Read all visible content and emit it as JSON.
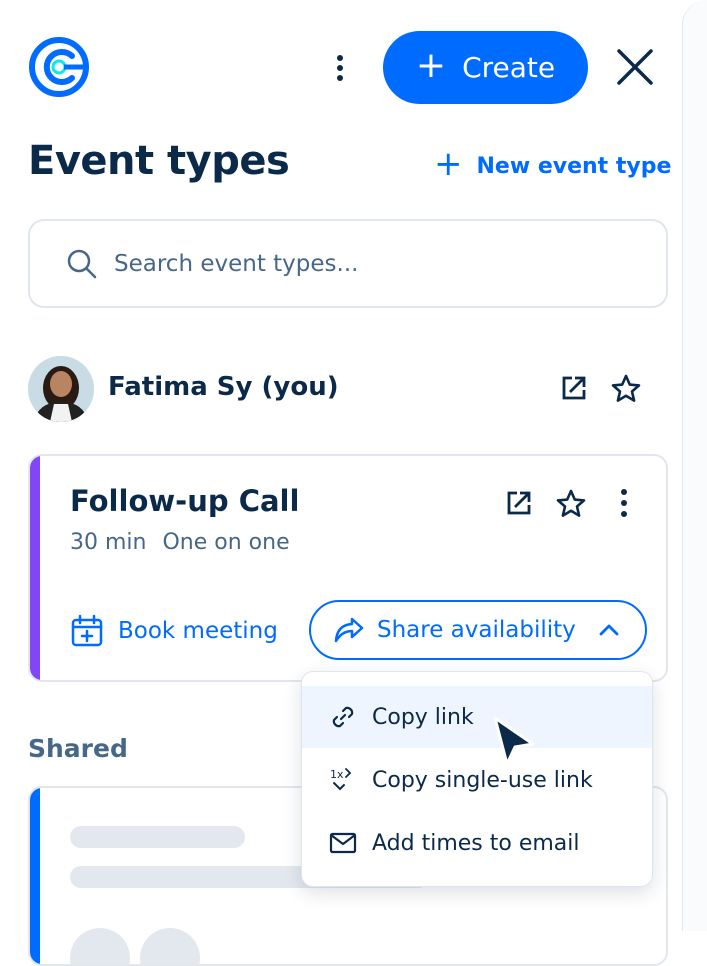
{
  "header": {
    "create_label": "Create",
    "more_icon": "vertical-dots-icon",
    "close_icon": "close-x-icon",
    "logo_icon": "calendly-logo"
  },
  "page": {
    "title": "Event types",
    "new_event_label": "New event type"
  },
  "search": {
    "placeholder": "Search event types..."
  },
  "user": {
    "name": "Fatima Sy (you)"
  },
  "event_card": {
    "title": "Follow-up Call",
    "duration": "30 min",
    "kind": "One on one",
    "book_label": "Book meeting",
    "share_label": "Share availability",
    "accent_color": "#8247f5"
  },
  "share_menu": {
    "items": [
      {
        "label": "Copy link",
        "icon": "link-icon"
      },
      {
        "label": "Copy single-use link",
        "icon": "single-use-link-icon"
      },
      {
        "label": "Add times to email",
        "icon": "envelope-icon"
      }
    ]
  },
  "shared": {
    "label": "Shared"
  },
  "colors": {
    "brand_blue": "#006bff",
    "text_dark": "#0b2a4a",
    "text_muted": "#476788"
  }
}
